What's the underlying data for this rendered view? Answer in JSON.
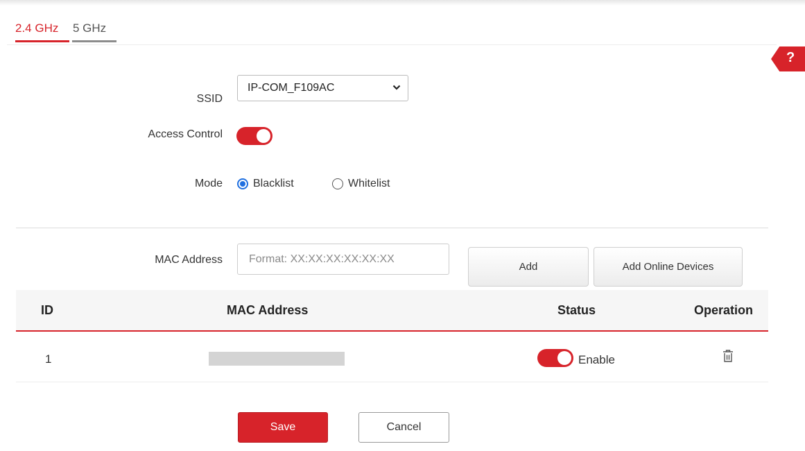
{
  "tabs": [
    {
      "label": "2.4 GHz",
      "active": true
    },
    {
      "label": "5 GHz",
      "active": false
    }
  ],
  "help": {
    "label": "?"
  },
  "form": {
    "ssid_label": "SSID",
    "ssid_value": "IP-COM_F109AC",
    "access_control_label": "Access Control",
    "access_control_on": true,
    "mode_label": "Mode",
    "mode_options": [
      "Blacklist",
      "Whitelist"
    ],
    "mode_selected": "Blacklist",
    "mac_label": "MAC Address",
    "mac_placeholder": "Format: XX:XX:XX:XX:XX:XX",
    "add_button": "Add",
    "add_online_button": "Add Online Devices"
  },
  "table": {
    "columns": [
      "ID",
      "MAC Address",
      "Status",
      "Operation"
    ],
    "rows": [
      {
        "id": "1",
        "mac": "",
        "status_on": true,
        "status_label": "Enable"
      }
    ]
  },
  "footer": {
    "save": "Save",
    "cancel": "Cancel"
  },
  "colors": {
    "accent": "#d7232a",
    "radio": "#1f6fe0"
  }
}
